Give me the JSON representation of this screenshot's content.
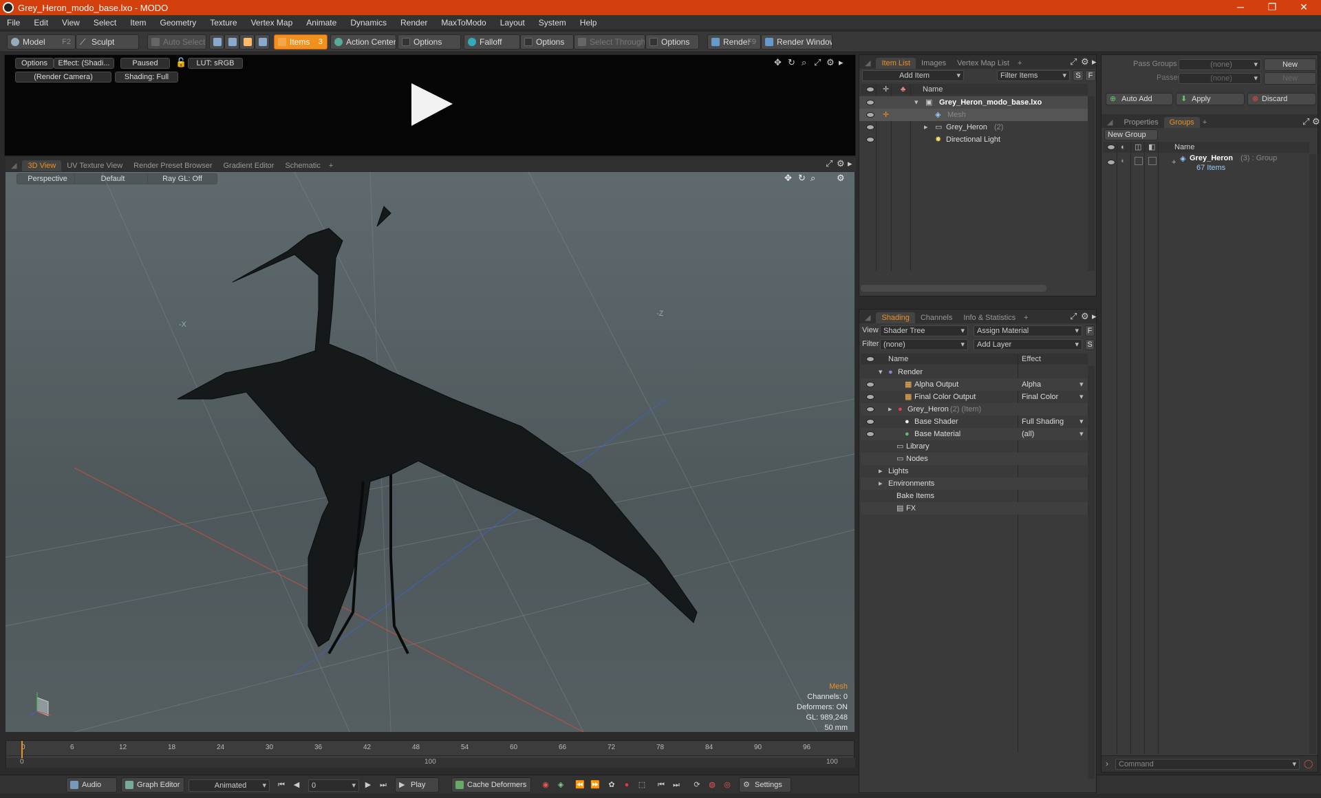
{
  "window": {
    "title": "Grey_Heron_modo_base.lxo - MODO",
    "controls": {
      "minimize": "─",
      "maximize": "❐",
      "close": "✕"
    }
  },
  "menu": [
    "File",
    "Edit",
    "View",
    "Select",
    "Item",
    "Geometry",
    "Texture",
    "Vertex Map",
    "Animate",
    "Dynamics",
    "Render",
    "MaxToModo",
    "Layout",
    "System",
    "Help"
  ],
  "toolbar": {
    "model": "Model",
    "model_key": "F2",
    "sculpt": "Sculpt",
    "auto_select": "Auto Select",
    "items": "Items",
    "items_key": "3",
    "action_center": "Action Center",
    "options1": "Options",
    "falloff": "Falloff",
    "options2": "Options",
    "select_through": "Select Through",
    "options3": "Options",
    "render": "Render",
    "render_key": "F9",
    "render_window": "Render Window"
  },
  "preview": {
    "options": "Options",
    "effect": "Effect: (Shadi...",
    "paused": "Paused",
    "lut": "LUT: sRGB",
    "camera": "(Render Camera)",
    "shading": "Shading: Full"
  },
  "viewport_tabs": [
    "3D View",
    "UV Texture View",
    "Render Preset Browser",
    "Gradient Editor",
    "Schematic",
    "+"
  ],
  "viewport": {
    "perspective": "Perspective",
    "default": "Default",
    "raygl": "Ray GL: Off",
    "info": {
      "mesh": "Mesh",
      "channels": "Channels: 0",
      "deformers": "Deformers: ON",
      "gl": "GL: 989,248",
      "scale": "50 mm"
    },
    "axis_labels": {
      "x": "-X",
      "z": "-Z"
    }
  },
  "timeline": {
    "ticks": [
      "0",
      "6",
      "12",
      "18",
      "24",
      "30",
      "36",
      "42",
      "48",
      "54",
      "60",
      "66",
      "72",
      "78",
      "84",
      "90",
      "96"
    ],
    "range_start": "0",
    "range_mid": "100",
    "range_end": "100"
  },
  "bottom": {
    "audio": "Audio",
    "graph_editor": "Graph Editor",
    "animated": "Animated",
    "frame": "0",
    "play": "Play",
    "cache_deformers": "Cache Deformers",
    "settings": "Settings"
  },
  "item_list": {
    "tabs": [
      "Item List",
      "Images",
      "Vertex Map List",
      "+"
    ],
    "add_item": "Add Item",
    "filter_items": "Filter Items",
    "s": "S",
    "f": "F",
    "col_name": "Name",
    "rows": [
      {
        "label": "Grey_Heron_modo_base.lxo",
        "bold": true
      },
      {
        "label": "Mesh",
        "dim": true
      },
      {
        "label": "Grey_Heron",
        "suffix": "(2)"
      },
      {
        "label": "Directional Light"
      }
    ]
  },
  "shading": {
    "tabs": [
      "Shading",
      "Channels",
      "Info & Statistics",
      "+"
    ],
    "view_label": "View",
    "view_value": "Shader Tree",
    "assign_material": "Assign Material",
    "filter_label": "Filter",
    "filter_value": "(none)",
    "add_layer": "Add Layer",
    "col_name": "Name",
    "col_effect": "Effect",
    "rows": [
      {
        "label": "Render",
        "effect": ""
      },
      {
        "label": "Alpha Output",
        "effect": "Alpha"
      },
      {
        "label": "Final Color Output",
        "effect": "Final Color"
      },
      {
        "label": "Grey_Heron",
        "suffix": "(2) (Item)",
        "effect": ""
      },
      {
        "label": "Base Shader",
        "effect": "Full Shading"
      },
      {
        "label": "Base Material",
        "effect": "(all)"
      },
      {
        "label": "Library",
        "effect": ""
      },
      {
        "label": "Nodes",
        "effect": ""
      },
      {
        "label": "Lights",
        "effect": ""
      },
      {
        "label": "Environments",
        "effect": ""
      },
      {
        "label": "Bake Items",
        "effect": ""
      },
      {
        "label": "FX",
        "effect": ""
      }
    ]
  },
  "groups_panel": {
    "pass_groups": "Pass Groups",
    "passes": "Passes",
    "none": "(none)",
    "new": "New",
    "auto_add": "Auto Add",
    "apply": "Apply",
    "discard": "Discard",
    "tabs": [
      "Properties",
      "Groups",
      "+"
    ],
    "new_group": "New Group",
    "col_name": "Name",
    "group_name": "Grey_Heron",
    "group_suffix": "(3) : Group",
    "group_count": "67 Items",
    "command": "Command"
  },
  "colors": {
    "accent": "#f0901e",
    "title_bar": "#d4400d"
  }
}
